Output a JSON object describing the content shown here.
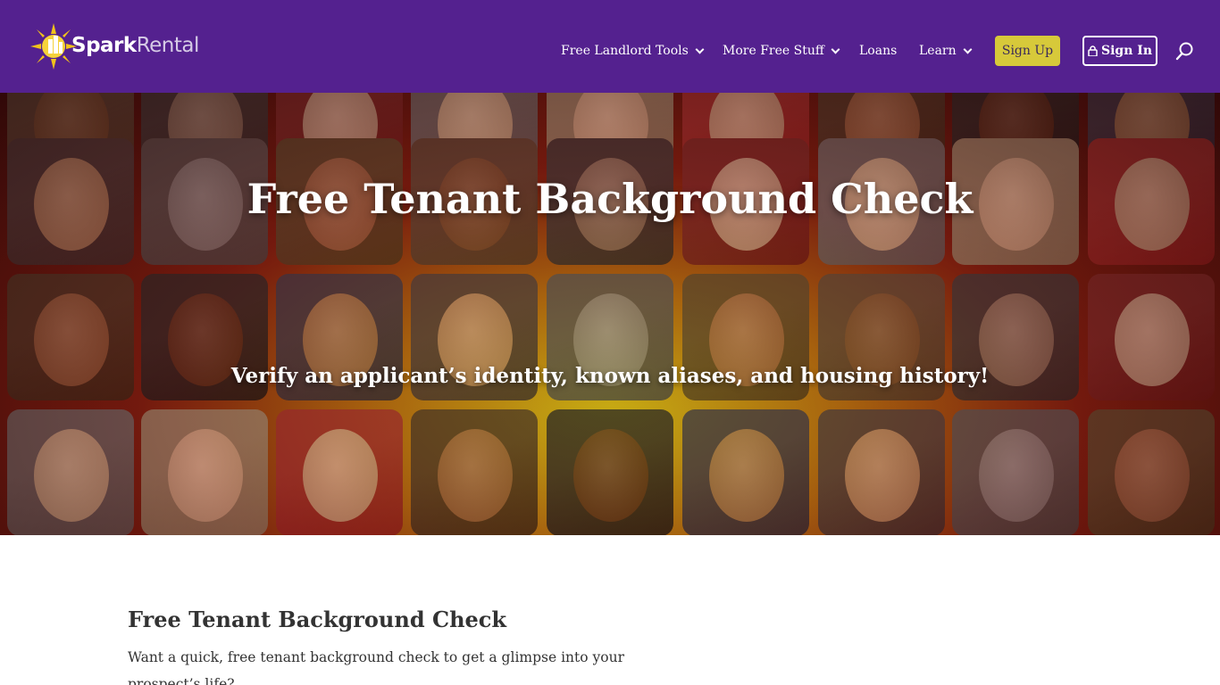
{
  "header": {
    "logo_spark": "Spark",
    "logo_rental": "Rental",
    "nav": [
      {
        "label": "Free Landlord Tools",
        "dropdown": true
      },
      {
        "label": "More Free Stuff",
        "dropdown": true
      },
      {
        "label": "Loans",
        "dropdown": false
      },
      {
        "label": "Learn",
        "dropdown": true
      }
    ],
    "signup_label": "Sign Up",
    "signin_label": "Sign In",
    "search_icon": "search-icon"
  },
  "hero": {
    "title": "Free Tenant Background Check",
    "subtitle": "Verify an applicant’s identity, known aliases, and housing history!"
  },
  "content": {
    "title": "Free Tenant Background Check",
    "text": "Want a quick, free tenant background check to get a glimpse into your prospect’s life?"
  },
  "colors": {
    "header_bg": "#54218f",
    "signup_bg": "#d7c93a",
    "text_dark": "#333333"
  }
}
